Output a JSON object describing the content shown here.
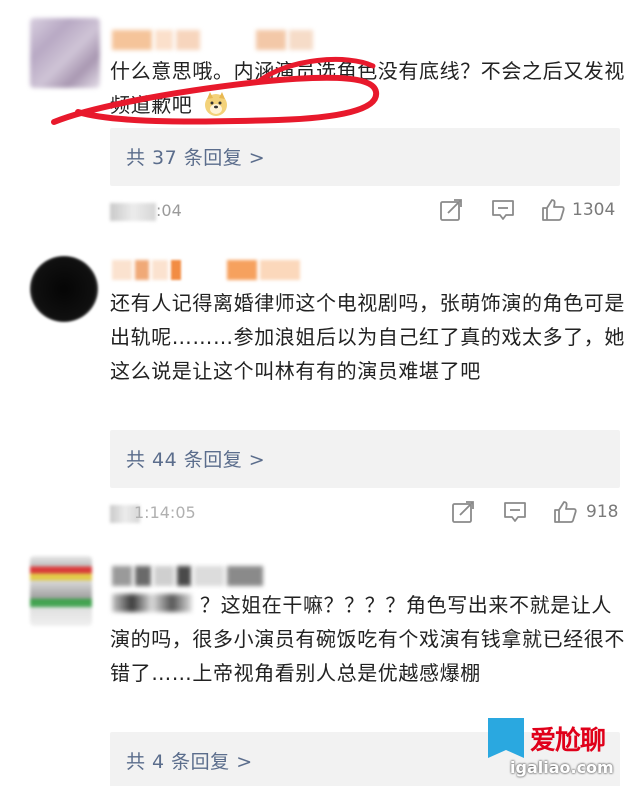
{
  "comments": [
    {
      "text": "什么意思哦。内涵演员选角色没有底线？不会之后又发视频道歉吧",
      "emoji": "doge",
      "replies": "共 37 条回复 >",
      "time": ":04",
      "likes": "1304"
    },
    {
      "text": "还有人记得离婚律师这个电视剧吗，张萌饰演的角色可是出轨呢………参加浪姐后以为自己红了真的戏太多了，她这么说是让这个叫林有有的演员难堪了吧",
      "replies": "共 44 条回复 >",
      "time": "1:14:05",
      "likes": "918"
    },
    {
      "text": "？这姐在干嘛？？？？角色写出来不就是让人演的吗，很多小演员有碗饭吃有个戏演有钱拿就已经很不错了……上帝视角看别人总是优越感爆棚",
      "replies": "共 4 条回复 >"
    }
  ],
  "icons": {
    "share": "share-icon",
    "comment": "comment-icon",
    "like": "thumbs-up-icon"
  },
  "colors": {
    "reply_link": "#5b6d8c",
    "annotation_circle": "#e8192c"
  },
  "watermark": {
    "title": "爱尬聊",
    "url": "igaliao.com"
  }
}
